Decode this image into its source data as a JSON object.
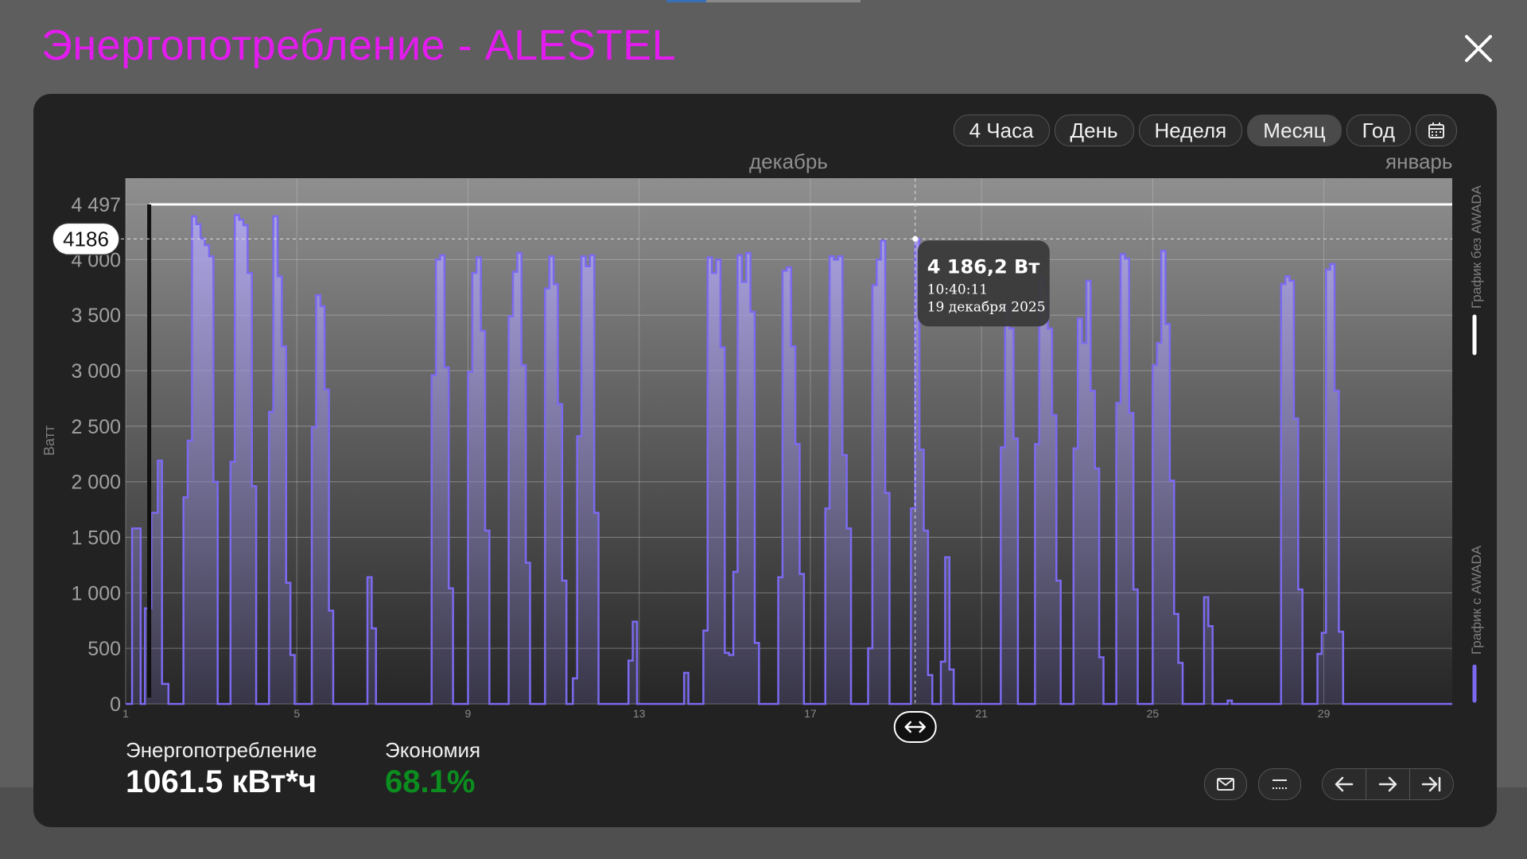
{
  "title": "Энергопотребление - ALESTEL",
  "periods": [
    {
      "label": "4 Часа",
      "active": false
    },
    {
      "label": "День",
      "active": false
    },
    {
      "label": "Неделя",
      "active": false
    },
    {
      "label": "Месяц",
      "active": true
    },
    {
      "label": "Год",
      "active": false
    }
  ],
  "months": {
    "current": "декабрь",
    "next": "январь"
  },
  "side_labels": {
    "top": "График без AWADA",
    "bottom": "График с AWADA"
  },
  "colors": {
    "title": "#e31bef",
    "series": "#7b6af0",
    "economy": "#0c8d1f"
  },
  "icons": {
    "close": "close-icon",
    "calendar": "calendar-icon",
    "drag": "horizontal-drag-icon",
    "mail": "mail-icon",
    "menu": "menu-icon",
    "prev": "arrow-left-icon",
    "next": "arrow-right-icon",
    "last": "arrow-to-end-icon"
  },
  "chart_data": {
    "type": "area",
    "ylabel": "Ватт",
    "ylim": [
      0,
      4497
    ],
    "max_line": 4497,
    "y_ticks": [
      "0",
      "500",
      "1 000",
      "1 500",
      "2 000",
      "2 500",
      "3 000",
      "3 500",
      "4 000",
      "4 497"
    ],
    "x_ticks": [
      "1",
      "5",
      "9",
      "13",
      "17",
      "21",
      "25",
      "29"
    ],
    "x_range": [
      1,
      32
    ],
    "cursor": {
      "value_label": "4186",
      "value": 4186.2,
      "x": 19.45
    },
    "tooltip": {
      "value": "4 186,2 Вт",
      "time": "10:40:11",
      "date": "19 декабря 2025"
    },
    "series": [
      {
        "values": [
          [
            1.0,
            0
          ],
          [
            1.15,
            1580
          ],
          [
            1.35,
            0
          ],
          [
            1.45,
            860
          ],
          [
            1.6,
            1720
          ],
          [
            1.75,
            2190
          ],
          [
            1.85,
            180
          ],
          [
            2.0,
            0
          ],
          [
            2.3,
            0
          ],
          [
            2.35,
            1860
          ],
          [
            2.45,
            2370
          ],
          [
            2.55,
            4390
          ],
          [
            2.65,
            4320
          ],
          [
            2.75,
            4190
          ],
          [
            2.85,
            4130
          ],
          [
            2.95,
            4030
          ],
          [
            3.05,
            2000
          ],
          [
            3.15,
            0
          ],
          [
            3.4,
            0
          ],
          [
            3.45,
            2180
          ],
          [
            3.55,
            4400
          ],
          [
            3.65,
            4360
          ],
          [
            3.75,
            4310
          ],
          [
            3.85,
            3880
          ],
          [
            3.95,
            1960
          ],
          [
            4.05,
            0
          ],
          [
            4.3,
            0
          ],
          [
            4.35,
            2630
          ],
          [
            4.45,
            4390
          ],
          [
            4.55,
            3850
          ],
          [
            4.65,
            3220
          ],
          [
            4.75,
            1090
          ],
          [
            4.85,
            440
          ],
          [
            4.95,
            0
          ],
          [
            5.3,
            0
          ],
          [
            5.35,
            2490
          ],
          [
            5.45,
            3680
          ],
          [
            5.55,
            3580
          ],
          [
            5.65,
            2830
          ],
          [
            5.75,
            840
          ],
          [
            5.85,
            0
          ],
          [
            6.6,
            0
          ],
          [
            6.65,
            1140
          ],
          [
            6.75,
            680
          ],
          [
            6.85,
            0
          ],
          [
            8.1,
            0
          ],
          [
            8.15,
            2960
          ],
          [
            8.25,
            4000
          ],
          [
            8.35,
            4040
          ],
          [
            8.45,
            3030
          ],
          [
            8.55,
            1040
          ],
          [
            8.65,
            0
          ],
          [
            8.95,
            0
          ],
          [
            9.0,
            2990
          ],
          [
            9.1,
            3880
          ],
          [
            9.2,
            4020
          ],
          [
            9.3,
            3360
          ],
          [
            9.4,
            1560
          ],
          [
            9.5,
            0
          ],
          [
            9.9,
            0
          ],
          [
            9.95,
            3490
          ],
          [
            10.05,
            3890
          ],
          [
            10.15,
            4060
          ],
          [
            10.25,
            3050
          ],
          [
            10.35,
            1270
          ],
          [
            10.45,
            0
          ],
          [
            10.75,
            0
          ],
          [
            10.8,
            3740
          ],
          [
            10.9,
            4030
          ],
          [
            11.0,
            3780
          ],
          [
            11.1,
            2700
          ],
          [
            11.2,
            1110
          ],
          [
            11.3,
            0
          ],
          [
            11.4,
            0
          ],
          [
            11.45,
            230
          ],
          [
            11.55,
            2410
          ],
          [
            11.65,
            4030
          ],
          [
            11.75,
            3940
          ],
          [
            11.85,
            4040
          ],
          [
            11.95,
            1720
          ],
          [
            12.05,
            0
          ],
          [
            12.7,
            0
          ],
          [
            12.75,
            390
          ],
          [
            12.85,
            740
          ],
          [
            12.95,
            0
          ],
          [
            14.0,
            0
          ],
          [
            14.05,
            280
          ],
          [
            14.15,
            0
          ],
          [
            14.45,
            0
          ],
          [
            14.5,
            660
          ],
          [
            14.6,
            4020
          ],
          [
            14.7,
            3880
          ],
          [
            14.8,
            4000
          ],
          [
            14.9,
            3210
          ],
          [
            15.0,
            460
          ],
          [
            15.1,
            440
          ],
          [
            15.2,
            1190
          ],
          [
            15.3,
            4040
          ],
          [
            15.4,
            3800
          ],
          [
            15.5,
            4060
          ],
          [
            15.6,
            3530
          ],
          [
            15.7,
            550
          ],
          [
            15.8,
            0
          ],
          [
            16.2,
            0
          ],
          [
            16.25,
            1140
          ],
          [
            16.35,
            3900
          ],
          [
            16.45,
            3930
          ],
          [
            16.55,
            3220
          ],
          [
            16.65,
            2340
          ],
          [
            16.75,
            1170
          ],
          [
            16.85,
            0
          ],
          [
            17.3,
            0
          ],
          [
            17.35,
            1760
          ],
          [
            17.45,
            4030
          ],
          [
            17.55,
            4000
          ],
          [
            17.65,
            4030
          ],
          [
            17.75,
            2240
          ],
          [
            17.85,
            1580
          ],
          [
            17.95,
            0
          ],
          [
            18.3,
            0
          ],
          [
            18.35,
            500
          ],
          [
            18.45,
            3770
          ],
          [
            18.55,
            4000
          ],
          [
            18.65,
            4170
          ],
          [
            18.75,
            1900
          ],
          [
            18.85,
            0
          ],
          [
            19.3,
            0
          ],
          [
            19.35,
            1760
          ],
          [
            19.45,
            4186
          ],
          [
            19.55,
            2290
          ],
          [
            19.65,
            1560
          ],
          [
            19.75,
            260
          ],
          [
            19.85,
            0
          ],
          [
            20.0,
            0
          ],
          [
            20.05,
            380
          ],
          [
            20.15,
            1320
          ],
          [
            20.25,
            310
          ],
          [
            20.35,
            0
          ],
          [
            21.4,
            0
          ],
          [
            21.45,
            2310
          ],
          [
            21.55,
            3570
          ],
          [
            21.65,
            3380
          ],
          [
            21.75,
            2390
          ],
          [
            21.85,
            0
          ],
          [
            22.2,
            0
          ],
          [
            22.25,
            2340
          ],
          [
            22.35,
            3840
          ],
          [
            22.45,
            3750
          ],
          [
            22.55,
            3380
          ],
          [
            22.65,
            2600
          ],
          [
            22.75,
            1110
          ],
          [
            22.85,
            0
          ],
          [
            23.1,
            0
          ],
          [
            23.15,
            2300
          ],
          [
            23.25,
            3470
          ],
          [
            23.35,
            3250
          ],
          [
            23.45,
            3810
          ],
          [
            23.55,
            2820
          ],
          [
            23.65,
            2120
          ],
          [
            23.75,
            420
          ],
          [
            23.85,
            0
          ],
          [
            24.1,
            0
          ],
          [
            24.15,
            2710
          ],
          [
            24.25,
            4050
          ],
          [
            24.35,
            4010
          ],
          [
            24.45,
            2620
          ],
          [
            24.55,
            1030
          ],
          [
            24.65,
            0
          ],
          [
            24.95,
            0
          ],
          [
            25.0,
            3050
          ],
          [
            25.1,
            3250
          ],
          [
            25.2,
            4080
          ],
          [
            25.3,
            3420
          ],
          [
            25.4,
            2010
          ],
          [
            25.5,
            810
          ],
          [
            25.6,
            370
          ],
          [
            25.7,
            0
          ],
          [
            26.15,
            0
          ],
          [
            26.2,
            960
          ],
          [
            26.3,
            700
          ],
          [
            26.4,
            0
          ],
          [
            26.7,
            0
          ],
          [
            26.75,
            30
          ],
          [
            26.85,
            0
          ],
          [
            27.95,
            0
          ],
          [
            28.0,
            3780
          ],
          [
            28.1,
            3850
          ],
          [
            28.2,
            3810
          ],
          [
            28.3,
            2570
          ],
          [
            28.4,
            1030
          ],
          [
            28.5,
            0
          ],
          [
            28.8,
            0
          ],
          [
            28.85,
            450
          ],
          [
            28.95,
            640
          ],
          [
            29.05,
            3910
          ],
          [
            29.15,
            3960
          ],
          [
            29.25,
            2820
          ],
          [
            29.35,
            650
          ],
          [
            29.45,
            0
          ],
          [
            30.6,
            0
          ]
        ]
      }
    ]
  },
  "stats": {
    "consumption_label": "Энергопотребление",
    "consumption_value": "1061.5 кВт*ч",
    "economy_label": "Экономия",
    "economy_value": "68.1%"
  }
}
